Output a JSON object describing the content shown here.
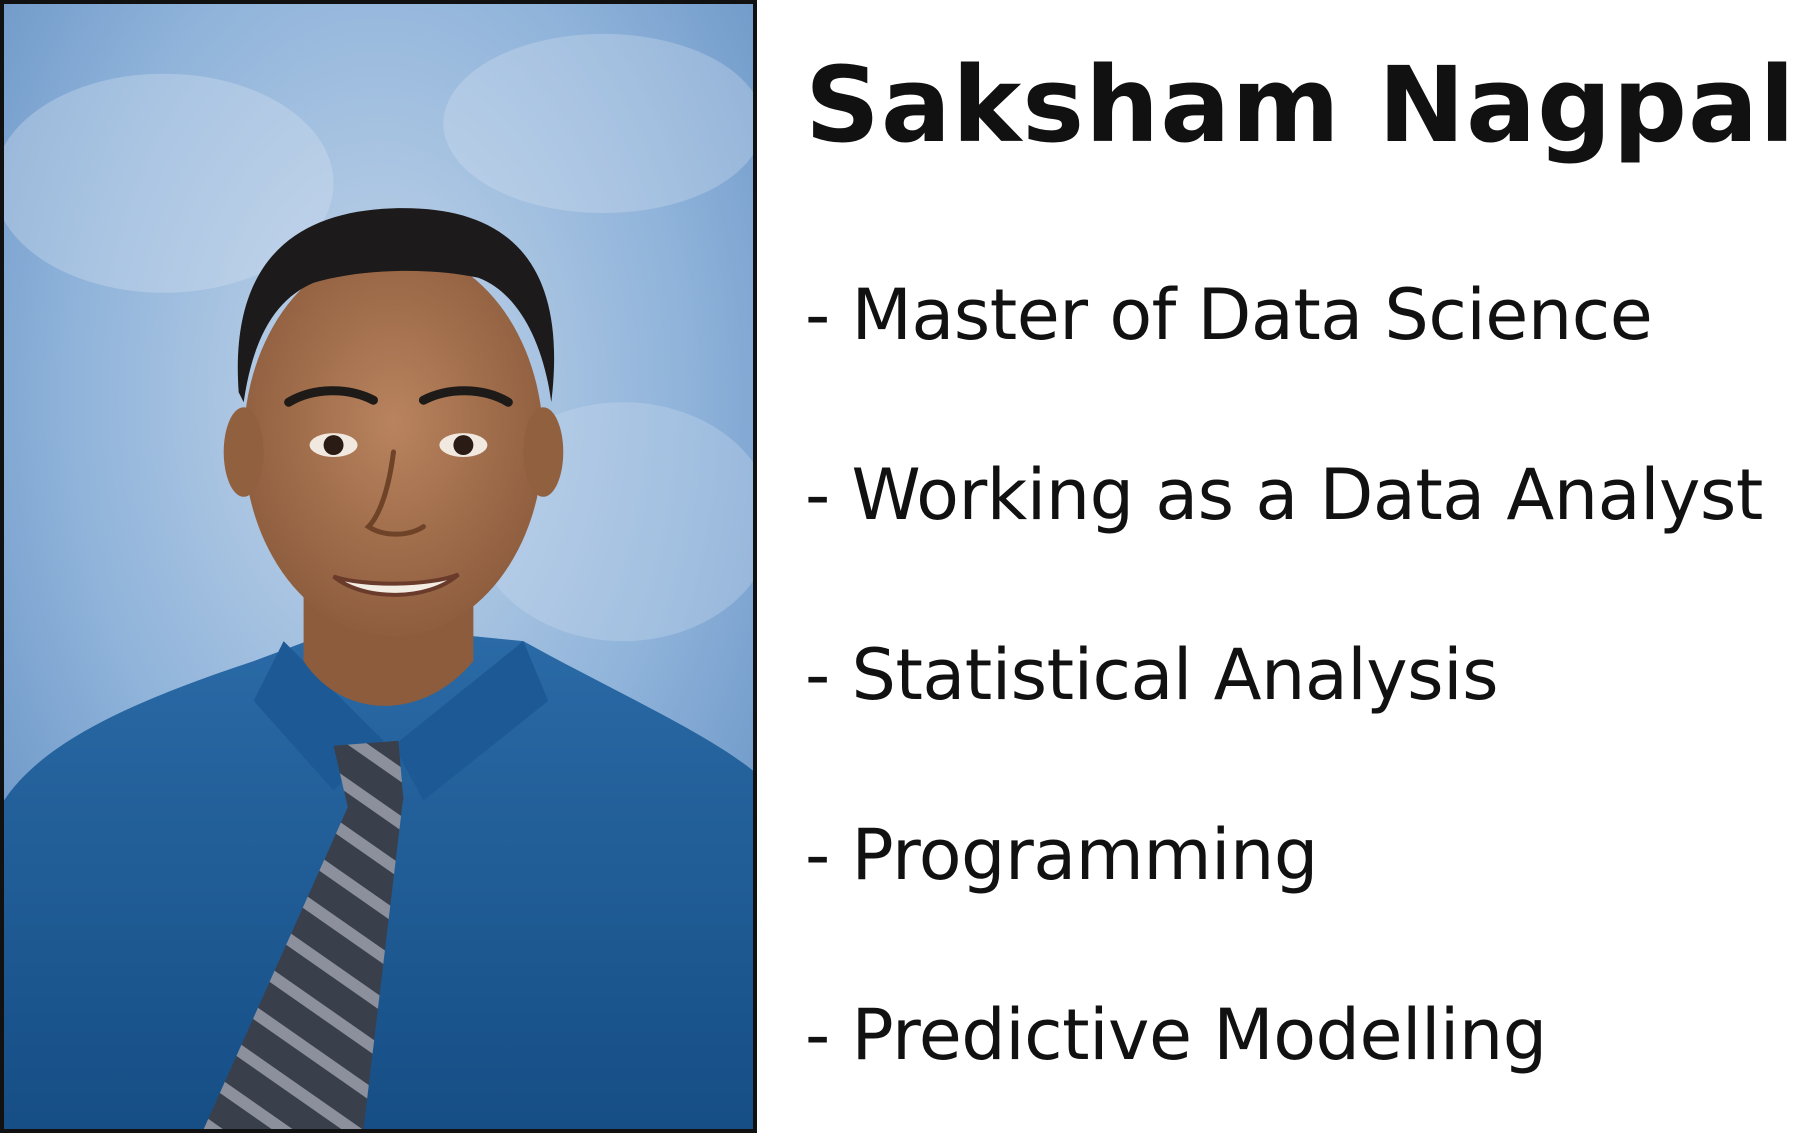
{
  "profile": {
    "name": "Saksham Nagpal",
    "bullets": [
      "- Master of Data Science",
      "- Working as a Data Analyst",
      "- Statistical Analysis",
      "- Programming",
      "- Predictive Modelling"
    ]
  },
  "photo": {
    "background_color": "#8fb0d6",
    "shirt_color": "#1f5c94",
    "tie_color": "#3c4150"
  }
}
